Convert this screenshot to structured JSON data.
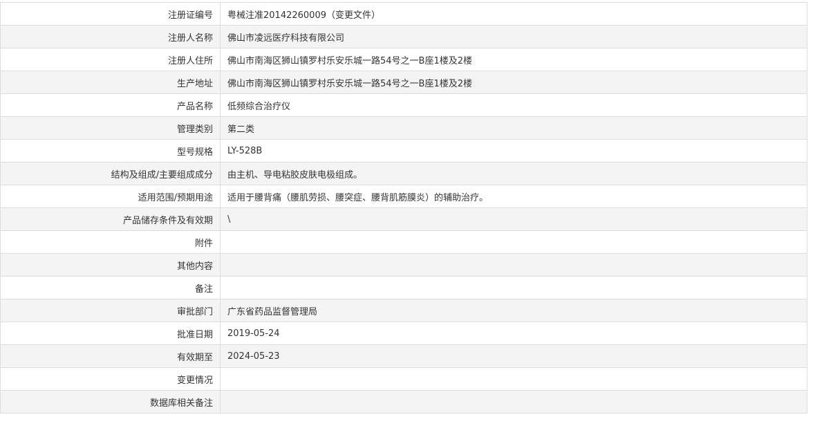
{
  "rows": [
    {
      "label": "注册证编号",
      "value": "粤械注准20142260009（变更文件）"
    },
    {
      "label": "注册人名称",
      "value": "佛山市凌远医疗科技有限公司"
    },
    {
      "label": "注册人住所",
      "value": "佛山市南海区狮山镇罗村乐安乐城一路54号之一B座1楼及2楼"
    },
    {
      "label": "生产地址",
      "value": "佛山市南海区狮山镇罗村乐安乐城一路54号之一B座1楼及2楼"
    },
    {
      "label": "产品名称",
      "value": "低频综合治疗仪"
    },
    {
      "label": "管理类别",
      "value": "第二类"
    },
    {
      "label": "型号规格",
      "value": "LY-528B"
    },
    {
      "label": "结构及组成/主要组成成分",
      "value": "由主机、导电粘胶皮肤电极组成。"
    },
    {
      "label": "适用范围/预期用途",
      "value": "适用于腰背痛（腰肌劳损、腰突症、腰背肌筋膜炎）的辅助治疗。"
    },
    {
      "label": "产品储存条件及有效期",
      "value": "\\"
    },
    {
      "label": "附件",
      "value": ""
    },
    {
      "label": "其他内容",
      "value": ""
    },
    {
      "label": "备注",
      "value": ""
    },
    {
      "label": "审批部门",
      "value": "广东省药品监督管理局"
    },
    {
      "label": "批准日期",
      "value": "2019-05-24"
    },
    {
      "label": "有效期至",
      "value": "2024-05-23"
    },
    {
      "label": "变更情况",
      "value": ""
    },
    {
      "label": "数据库相关备注",
      "value": ""
    }
  ]
}
